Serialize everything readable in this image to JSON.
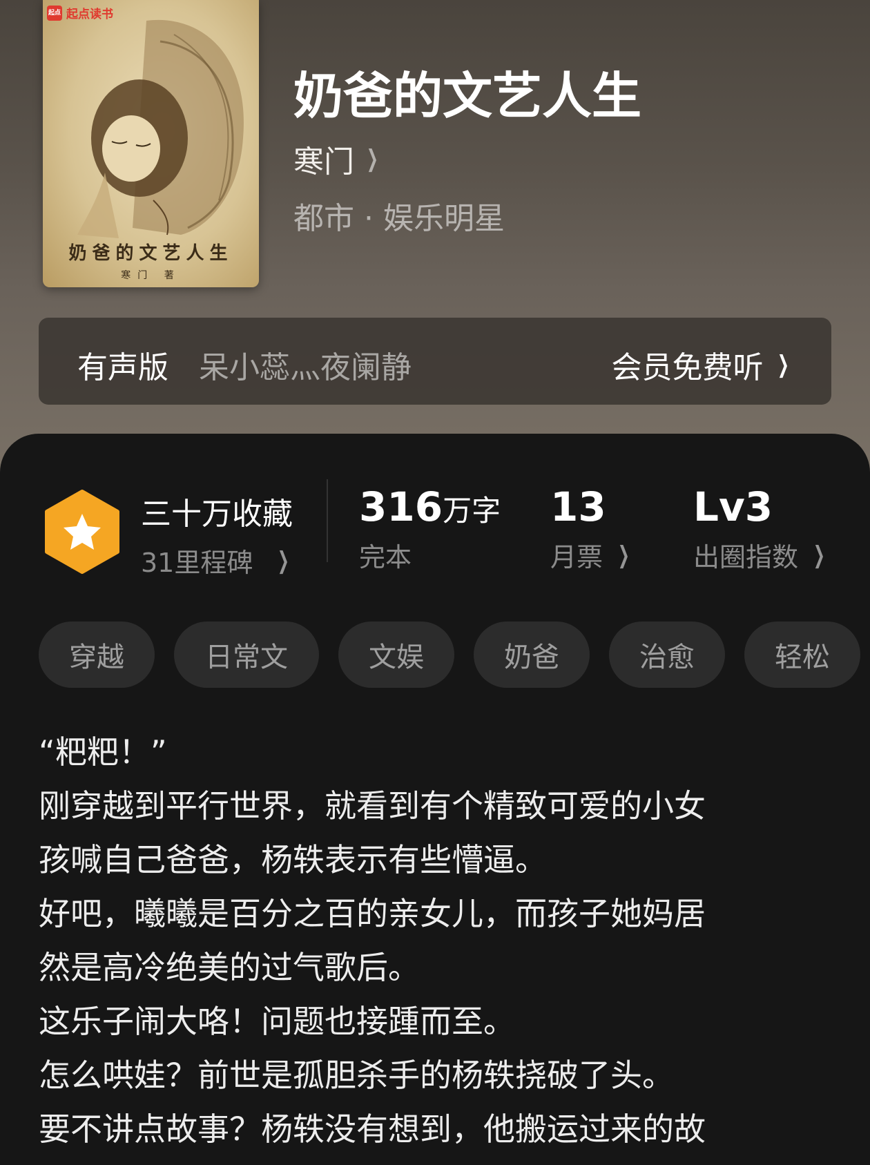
{
  "cover": {
    "brand": "起点读书",
    "brand_logo": "起点",
    "title": "奶爸的文艺人生",
    "author": "寒门 著"
  },
  "book": {
    "title": "奶爸的文艺人生",
    "author": "寒门",
    "genre": "都市 · 娱乐明星"
  },
  "audio": {
    "label": "有声版",
    "narrators": "呆小蕊灬夜阑静",
    "cta": "会员免费听"
  },
  "stats": {
    "collect_title": "三十万收藏",
    "collect_sub": "31里程碑",
    "words_num": "316",
    "words_unit": "万字",
    "words_status": "完本",
    "ticket_num": "13",
    "ticket_label": "月票",
    "circle_num": "Lv3",
    "circle_label": "出圈指数"
  },
  "tags": [
    "穿越",
    "日常文",
    "文娱",
    "奶爸",
    "治愈",
    "轻松"
  ],
  "synopsis": [
    "“粑粑！”",
    "刚穿越到平行世界，就看到有个精致可爱的小女",
    "孩喊自己爸爸，杨轶表示有些懵逼。",
    "好吧，曦曦是百分之百的亲女儿，而孩子她妈居",
    "然是高冷绝美的过气歌后。",
    "这乐子闹大咯！问题也接踵而至。",
    "怎么哄娃？前世是孤胆杀手的杨轶挠破了头。",
    "要不讲点故事？杨轶没有想到，他搬运过来的故"
  ],
  "colors": {
    "hero_bg": "#5a534b",
    "panel_bg": "#161616",
    "badge": "#f5a623",
    "tag_bg": "#2c2c2c"
  },
  "icons": [
    "chevron-right-icon",
    "star-badge-icon"
  ]
}
